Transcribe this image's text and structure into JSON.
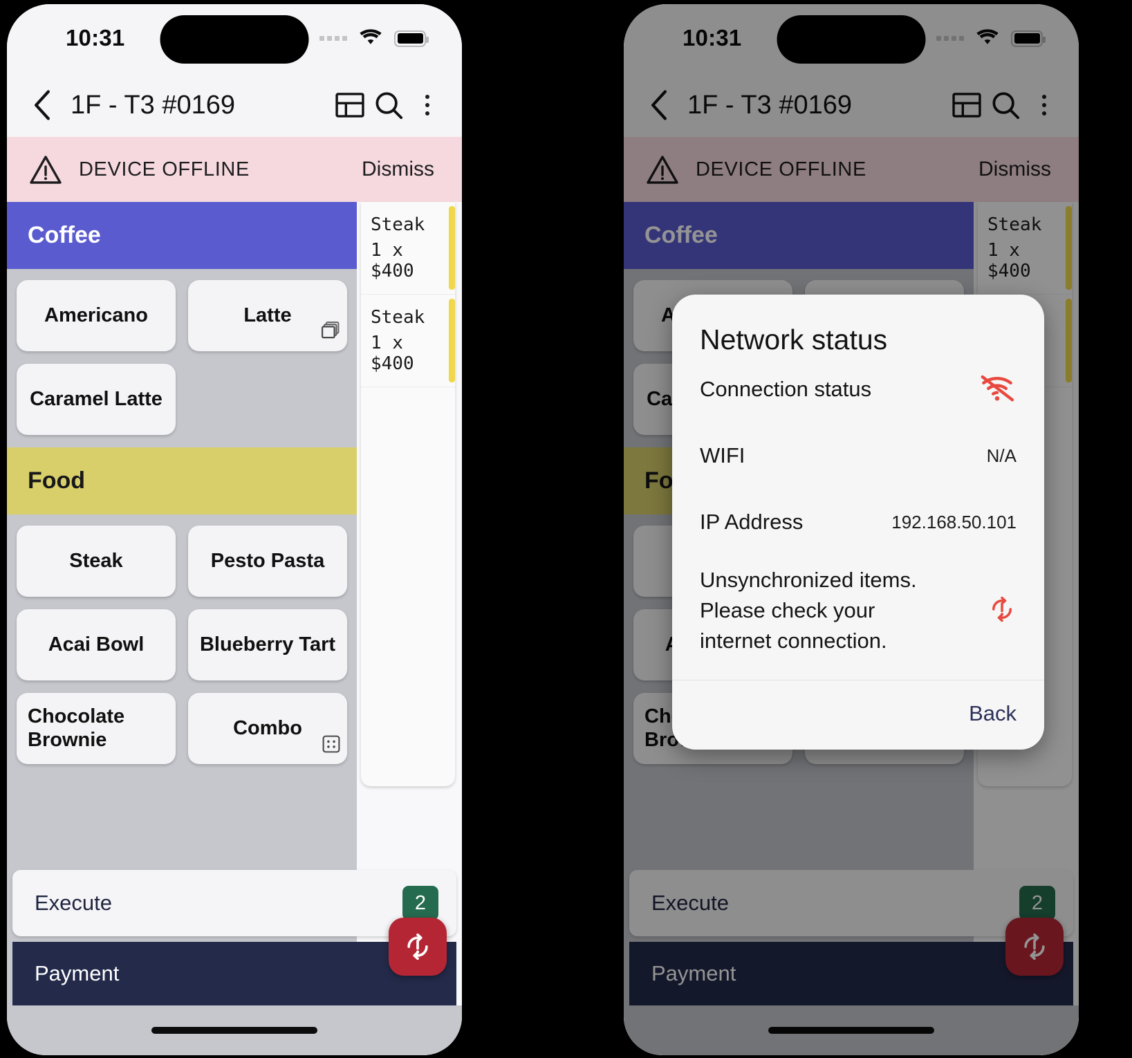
{
  "status_bar": {
    "time": "10:31",
    "signal_icon": "signal-dots-icon",
    "wifi_icon": "wifi-icon",
    "battery_icon": "battery-icon"
  },
  "app_bar": {
    "back_icon": "chevron-left-icon",
    "title": "1F - T3 #0169",
    "layout_icon": "layout-split-icon",
    "search_icon": "search-icon",
    "more_icon": "kebab-menu-icon"
  },
  "banner": {
    "warn_icon": "warning-triangle-icon",
    "text": "DEVICE OFFLINE",
    "dismiss_label": "Dismiss"
  },
  "menu": {
    "categories": [
      {
        "name": "Coffee",
        "color": "#5b5bd0",
        "text_color": "#ffffff",
        "items": [
          {
            "label": "Americano",
            "corner_icon": ""
          },
          {
            "label": "Latte",
            "corner_icon": "copy-stack-icon"
          },
          {
            "label": "Caramel Latte",
            "corner_icon": ""
          }
        ]
      },
      {
        "name": "Food",
        "color": "#d8cf6a",
        "text_color": "#18181a",
        "items": [
          {
            "label": "Steak",
            "corner_icon": ""
          },
          {
            "label": "Pesto Pasta",
            "corner_icon": ""
          },
          {
            "label": "Acai Bowl",
            "corner_icon": ""
          },
          {
            "label": "Blueberry Tart",
            "corner_icon": ""
          },
          {
            "label": "Chocolate Brownie",
            "corner_icon": "",
            "align": "left"
          },
          {
            "label": "Combo",
            "corner_icon": "grid-dots-icon"
          }
        ]
      }
    ]
  },
  "order_panel": {
    "items": [
      {
        "name": "Steak",
        "qty_price": "1  x  $400",
        "flag_color": "#f0d84a"
      },
      {
        "name": "Steak",
        "qty_price": "1  x  $400",
        "flag_color": "#f0d84a"
      }
    ],
    "collapse_icon": "chevron-left-icon"
  },
  "bottom": {
    "execute_label": "Execute",
    "execute_count": "2",
    "execute_count_color": "#256b4f",
    "payment_label": "Payment",
    "sync_icon": "sync-error-icon",
    "sync_color": "#b52634"
  },
  "dialog": {
    "title": "Network status",
    "rows": [
      {
        "key": "Connection status",
        "value": "",
        "icon": "wifi-off-icon",
        "icon_color": "#e8493f"
      },
      {
        "key": "WIFI",
        "value": "N/A",
        "icon": ""
      },
      {
        "key": "IP Address",
        "value": "192.168.50.101",
        "icon": ""
      }
    ],
    "message": "Unsynchronized items. Please check your internet connection.",
    "message_icon": "sync-error-icon",
    "message_icon_color": "#e8493f",
    "back_label": "Back"
  },
  "theme": {
    "banner_bg": "#f6d9de",
    "body_bg": "#c5c7cd",
    "tile_bg": "#f4f4f6",
    "payment_bg": "#242a4a",
    "dim_overlay": "rgba(0,0,0,0.42)"
  }
}
